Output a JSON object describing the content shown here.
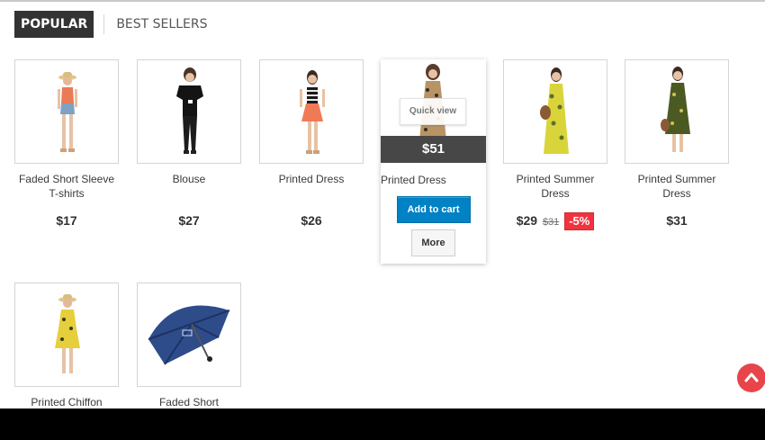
{
  "tabs": {
    "active_label": "Popular",
    "other_label": "Best Sellers"
  },
  "products": [
    {
      "name": "Faded Short Sleeve T-shirts",
      "price": "$17",
      "image": "woman-hat-tank-shorts"
    },
    {
      "name": "Blouse",
      "price": "$27",
      "image": "woman-black-blouse"
    },
    {
      "name": "Printed Dress",
      "price": "$26",
      "image": "woman-orange-skirt"
    },
    {
      "name": "Printed Dress",
      "price": "$51",
      "image": "woman-leopard-dress",
      "hovered": true,
      "quick_view_label": "Quick view",
      "add_to_cart_label": "Add to cart",
      "more_label": "More"
    },
    {
      "name": "Printed Summer Dress",
      "price": "$29",
      "old_price": "$31",
      "discount": "-5%",
      "image": "woman-yellow-maxi-dress"
    },
    {
      "name": "Printed Summer Dress",
      "price": "$31",
      "image": "woman-green-dress"
    },
    {
      "name": "Printed Chiffon",
      "image": "woman-yellow-chiffon-dress"
    },
    {
      "name": "Faded Short",
      "image": "blue-umbrella"
    }
  ],
  "colors": {
    "tab_active_bg": "#333333",
    "add_to_cart": "#0082c4",
    "discount_badge": "#f13340",
    "scroll_top": "#e8444c"
  },
  "scroll_top_icon": "chevron-up-icon"
}
